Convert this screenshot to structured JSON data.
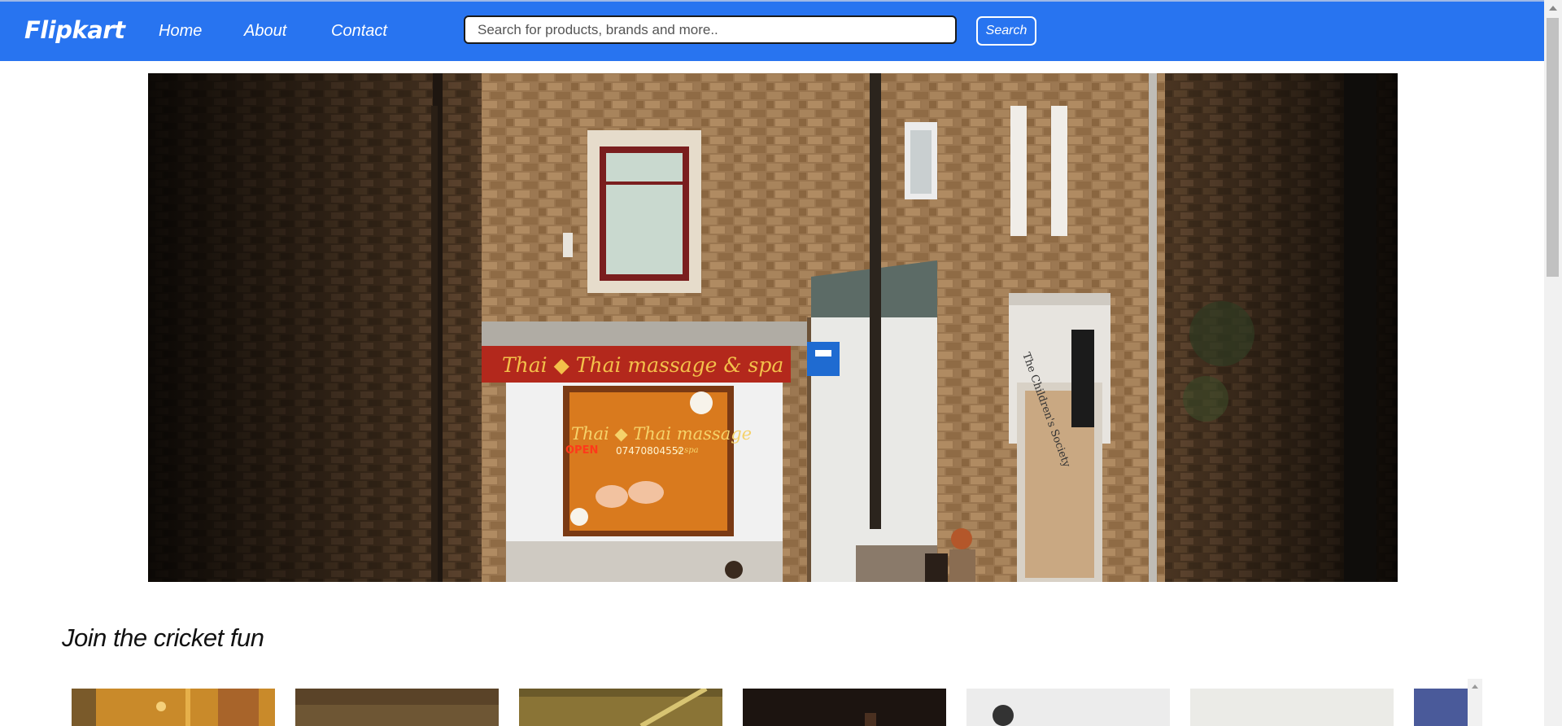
{
  "navbar": {
    "logo": "Flipkart",
    "links": [
      "Home",
      "About",
      "Contact"
    ],
    "search_placeholder": "Search for products, brands and more..",
    "search_button": "Search"
  },
  "hero": {
    "shop_sign": "Thai ◆ Thai massage & spa",
    "window_sign": "Thai ◆ Thai massage",
    "window_sub": "a spa",
    "open_text": "OPEN",
    "phone": "07470804552",
    "society_sign": "The Children's Society"
  },
  "section": {
    "title": "Join the cricket fun"
  },
  "colors": {
    "navbar": "#2874f0",
    "text": "#111111",
    "background": "#ffffff"
  }
}
